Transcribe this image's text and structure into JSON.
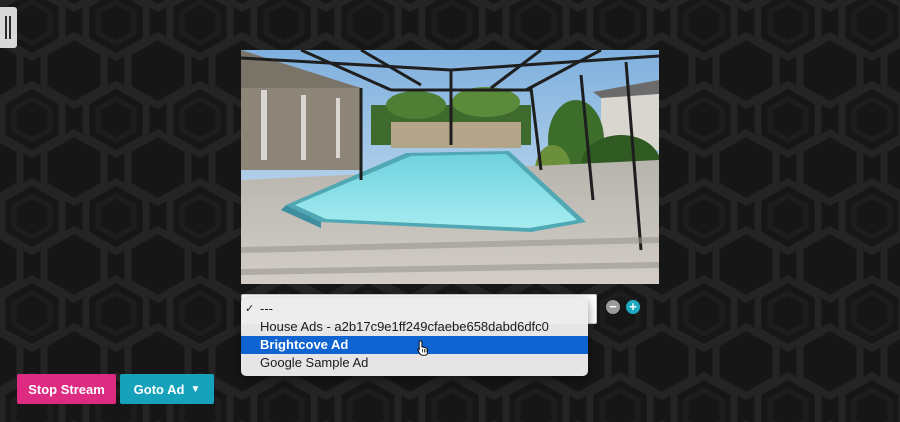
{
  "sidebar": {
    "icon": "sidebar-handle-icon"
  },
  "preview": {
    "subject": "screened pool enclosure",
    "icon": "video-preview"
  },
  "ad_select": {
    "options": [
      {
        "label": "---",
        "checked": true
      },
      {
        "label": "House Ads - a2b17c9e1ff249cfaebe658dabd6dfc0",
        "checked": false
      },
      {
        "label": "Brightcove Ad",
        "checked": false,
        "highlighted": true
      },
      {
        "label": "Google Sample Ad",
        "checked": false
      }
    ],
    "check_mark": "✓"
  },
  "controls": {
    "minus_label": "−",
    "plus_label": "+"
  },
  "actions": {
    "stop_stream_label": "Stop Stream",
    "goto_ad_label": "Goto Ad",
    "goto_ad_caret": "▼"
  },
  "colors": {
    "background": "#161616",
    "stop_button": "#dc2b80",
    "goto_button": "#17a2bc",
    "selection": "#0f64d2",
    "plus_button": "#1fa9bf"
  }
}
